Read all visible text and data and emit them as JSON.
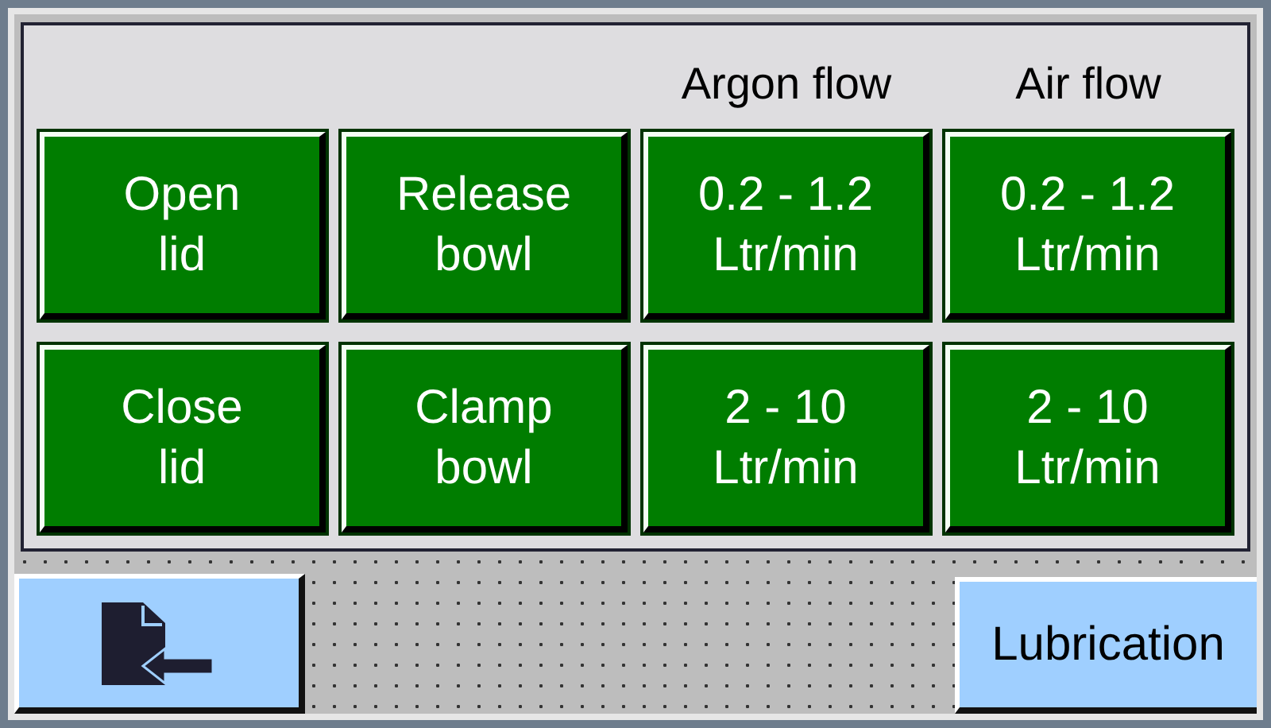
{
  "flow_headers": [
    {
      "label": "Argon flow"
    },
    {
      "label": "Air flow"
    }
  ],
  "buttons": [
    {
      "lines": [
        "Open",
        "lid"
      ]
    },
    {
      "lines": [
        "Release",
        "bowl"
      ]
    },
    {
      "lines": [
        "0.2 - 1.2",
        "Ltr/min"
      ]
    },
    {
      "lines": [
        "0.2 - 1.2",
        "Ltr/min"
      ]
    },
    {
      "lines": [
        "Close",
        "lid"
      ]
    },
    {
      "lines": [
        "Clamp",
        "bowl"
      ]
    },
    {
      "lines": [
        "2 - 10",
        "Ltr/min"
      ]
    },
    {
      "lines": [
        "2 - 10",
        "Ltr/min"
      ]
    }
  ],
  "footer": {
    "lubrication_button": "Lubrication"
  }
}
